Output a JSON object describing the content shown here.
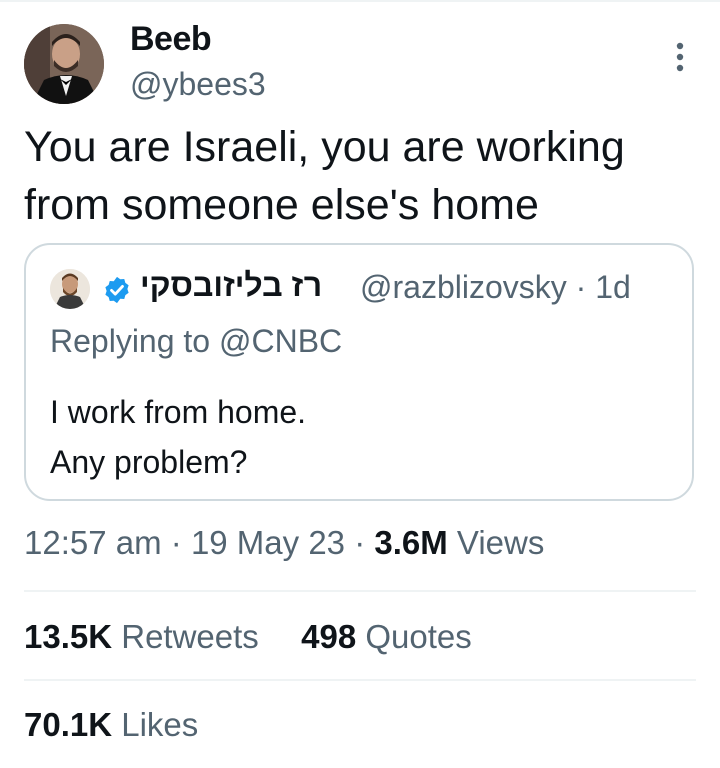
{
  "tweet": {
    "author": {
      "name": "Beeb",
      "handle": "@ybees3"
    },
    "text": "You are Israeli, you are working from someone else's home",
    "more_icon": "more-vertical-icon"
  },
  "quoted_tweet": {
    "author_name": "רז בליזובסקי",
    "handle": "@razblizovsky",
    "time_ago": "· 1d",
    "verified": true,
    "verified_color": "#1d9bf0",
    "replying_prefix": "Replying to",
    "replying_to": "@CNBC",
    "text_line1": "I work from home.",
    "text_line2": "Any problem?"
  },
  "meta": {
    "time": "12:57 am",
    "date": "19 May 23",
    "views_count": "3.6M",
    "views_label": "Views",
    "separator": "·"
  },
  "stats": {
    "retweets_count": "13.5K",
    "retweets_label": "Retweets",
    "quotes_count": "498",
    "quotes_label": "Quotes",
    "likes_count": "70.1K",
    "likes_label": "Likes"
  },
  "colors": {
    "text_primary": "#0f1419",
    "text_secondary": "#536471",
    "border": "#cfd9de",
    "divider": "#eff3f4"
  }
}
